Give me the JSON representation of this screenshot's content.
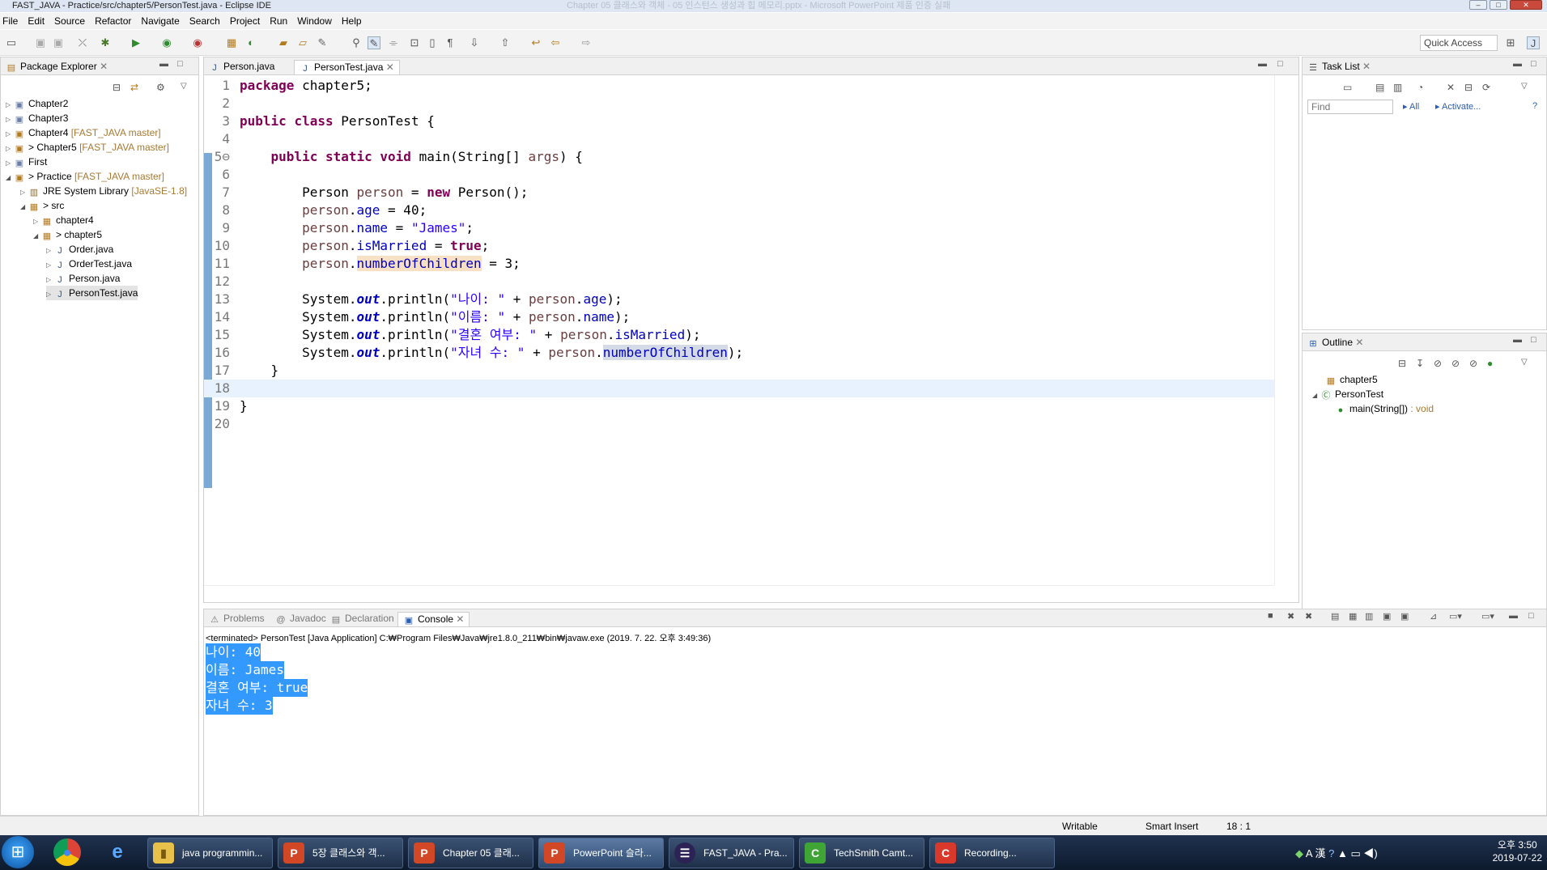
{
  "window": {
    "title": "FAST_JAVA - Practice/src/chapter5/PersonTest.java - Eclipse IDE",
    "background_title": "Chapter 05 클래스와 객체 - 05 인스턴스 생성과 힙 메모리.pptx - Microsoft PowerPoint 제품 인증 실패"
  },
  "menu": [
    "File",
    "Edit",
    "Source",
    "Refactor",
    "Navigate",
    "Search",
    "Project",
    "Run",
    "Window",
    "Help"
  ],
  "toolbar": {
    "quick_access": "Quick Access"
  },
  "package_explorer": {
    "title": "Package Explorer",
    "items": [
      {
        "label": "Chapter2",
        "decoration": ""
      },
      {
        "label": "Chapter3",
        "decoration": ""
      },
      {
        "label": "Chapter4",
        "decoration": "[FAST_JAVA master]"
      },
      {
        "label": "> Chapter5",
        "decoration": "[FAST_JAVA master]"
      },
      {
        "label": "First",
        "decoration": ""
      },
      {
        "label": "> Practice",
        "decoration": "[FAST_JAVA master]"
      },
      {
        "label": "JRE System Library",
        "decoration": "[JavaSE-1.8]"
      },
      {
        "label": "> src",
        "decoration": ""
      },
      {
        "label": "chapter4",
        "decoration": ""
      },
      {
        "label": "> chapter5",
        "decoration": ""
      },
      {
        "label": "Order.java",
        "decoration": ""
      },
      {
        "label": "OrderTest.java",
        "decoration": ""
      },
      {
        "label": "Person.java",
        "decoration": ""
      },
      {
        "label": "PersonTest.java",
        "decoration": ""
      }
    ]
  },
  "editor": {
    "tabs": [
      {
        "label": "Person.java"
      },
      {
        "label": "PersonTest.java"
      }
    ],
    "lines": [
      {
        "n": "1",
        "text": "package chapter5;"
      },
      {
        "n": "2",
        "text": ""
      },
      {
        "n": "3",
        "text": "public class PersonTest {"
      },
      {
        "n": "4",
        "text": ""
      },
      {
        "n": "5⊖",
        "text": "    public static void main(String[] args) {"
      },
      {
        "n": "6",
        "text": ""
      },
      {
        "n": "7",
        "text": "        Person person = new Person();"
      },
      {
        "n": "8",
        "text": "        person.age = 40;"
      },
      {
        "n": "9",
        "text": "        person.name = \"James\";"
      },
      {
        "n": "10",
        "text": "        person.isMarried = true;"
      },
      {
        "n": "11",
        "text": "        person.numberOfChildren = 3;"
      },
      {
        "n": "12",
        "text": ""
      },
      {
        "n": "13",
        "text": "        System.out.println(\"나이: \" + person.age);"
      },
      {
        "n": "14",
        "text": "        System.out.println(\"이름: \" + person.name);"
      },
      {
        "n": "15",
        "text": "        System.out.println(\"결혼 여부: \" + person.isMarried);"
      },
      {
        "n": "16",
        "text": "        System.out.println(\"자녀 수: \" + person.numberOfChildren);"
      },
      {
        "n": "17",
        "text": "    }"
      },
      {
        "n": "18",
        "text": ""
      },
      {
        "n": "19",
        "text": "}"
      },
      {
        "n": "20",
        "text": ""
      }
    ]
  },
  "task_list": {
    "title": "Task List",
    "find_placeholder": "Find",
    "all_label": "All",
    "activate_label": "Activate..."
  },
  "outline": {
    "title": "Outline",
    "items": [
      {
        "label": "chapter5",
        "detail": ""
      },
      {
        "label": "PersonTest",
        "detail": ""
      },
      {
        "label": "main(String[])",
        "detail": ": void"
      }
    ]
  },
  "bottom_tabs": [
    "Problems",
    "Javadoc",
    "Declaration",
    "Console"
  ],
  "console": {
    "header": "<terminated> PersonTest [Java Application] C:₩Program Files₩Java₩jre1.8.0_211₩bin₩javaw.exe (2019. 7. 22. 오후 3:49:36)",
    "lines": [
      "나이: 40",
      "이름: James",
      "결혼 여부: true",
      "자녀 수: 3"
    ]
  },
  "status_bar": {
    "writable": "Writable",
    "insert_mode": "Smart Insert",
    "position": "18 : 1"
  },
  "taskbar": {
    "buttons": [
      {
        "label": "java programmin...",
        "icon": "folder-icon",
        "color": "#e8c14a"
      },
      {
        "label": "5장 클래스와 객...",
        "icon": "powerpoint-icon",
        "color": "#d24726"
      },
      {
        "label": "Chapter 05 클래...",
        "icon": "powerpoint-icon",
        "color": "#d24726"
      },
      {
        "label": "PowerPoint 슬라...",
        "icon": "powerpoint-icon",
        "color": "#d24726"
      },
      {
        "label": "FAST_JAVA - Pra...",
        "icon": "eclipse-icon",
        "color": "#2c2255"
      },
      {
        "label": "TechSmith Camt...",
        "icon": "camtasia-icon",
        "color": "#3fa535"
      },
      {
        "label": "Recording...",
        "icon": "recording-icon",
        "color": "#d8392b"
      }
    ],
    "tray": "A 漢",
    "time": "오후 3:50",
    "date": "2019-07-22"
  }
}
